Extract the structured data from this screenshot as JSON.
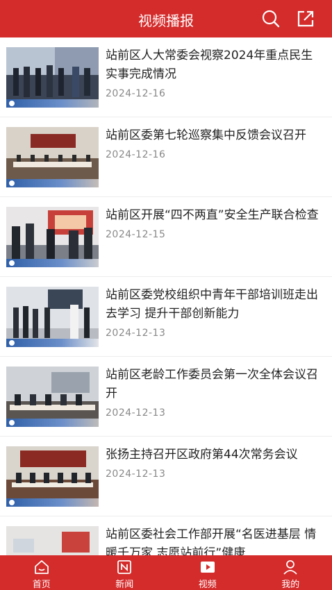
{
  "header": {
    "title": "视频播报"
  },
  "news": [
    {
      "title": "站前区人大常委会视察2024年重点民生实事完成情况",
      "date": "2024-12-16"
    },
    {
      "title": "站前区委第七轮巡察集中反馈会议召开",
      "date": "2024-12-16"
    },
    {
      "title": "站前区开展“四不两直”安全生产联合检查",
      "date": "2024-12-15"
    },
    {
      "title": "站前区委党校组织中青年干部培训班走出去学习 提升干部创新能力",
      "date": "2024-12-13"
    },
    {
      "title": "站前区老龄工作委员会第一次全体会议召开",
      "date": "2024-12-13"
    },
    {
      "title": "张扬主持召开区政府第44次常务会议",
      "date": "2024-12-13"
    },
    {
      "title": "站前区委社会工作部开展“名医进基层 情暖千万家 志愿站前行”健康",
      "date": ""
    }
  ],
  "tabbar": [
    {
      "label": "首页",
      "icon": "home-icon"
    },
    {
      "label": "新闻",
      "icon": "news-icon"
    },
    {
      "label": "视频",
      "icon": "video-icon"
    },
    {
      "label": "我的",
      "icon": "user-icon"
    }
  ],
  "colors": {
    "brand": "#d42b2b",
    "date": "#888888",
    "title": "#222222"
  }
}
